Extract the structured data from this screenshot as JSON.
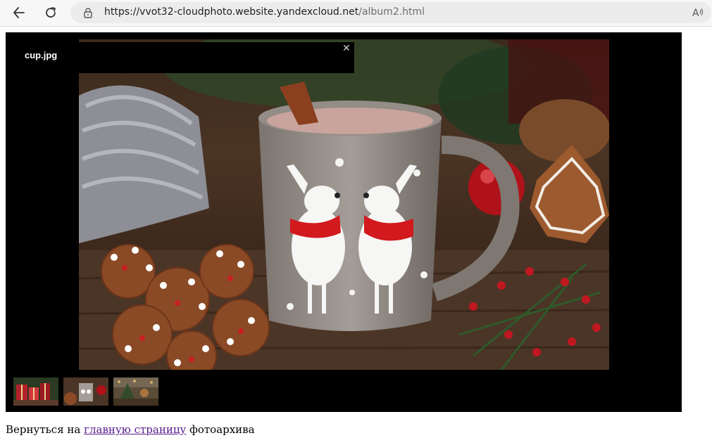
{
  "browser": {
    "url_host": "https://vvot32-cloudphoto.website.yandexcloud.net",
    "url_path": "/album2.html",
    "read_aloud_label": "A̩"
  },
  "gallery": {
    "caption": "cup.jpg",
    "close_symbol": "✕",
    "thumbnails": [
      "christmas-presents-thumbnail",
      "cup-thumbnail",
      "festive-room-thumbnail"
    ]
  },
  "footer": {
    "prefix": "Вернуться на",
    "link_text": "главную страницу",
    "suffix": "фотоархива"
  },
  "icons": {
    "back": "arrow-left-icon",
    "reload": "reload-icon",
    "lock": "lock-icon",
    "read_aloud": "read-aloud-icon"
  },
  "colors": {
    "gallery_bg": "#000000",
    "link": "#551a8b"
  }
}
